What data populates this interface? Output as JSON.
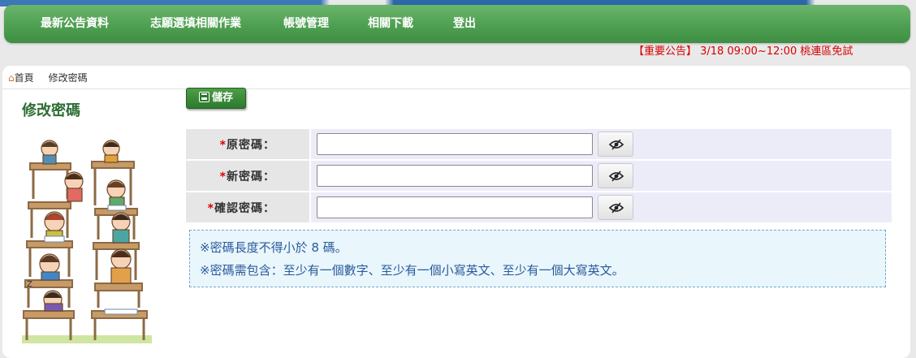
{
  "nav": {
    "items": [
      {
        "label": "最新公告資料"
      },
      {
        "label": "志願選填相關作業"
      },
      {
        "label": "帳號管理"
      },
      {
        "label": "相關下載"
      },
      {
        "label": "登出"
      }
    ]
  },
  "announcement": "【重要公告】 3/18 09:00~12:00 桃連區免試",
  "breadcrumb": {
    "home": "首頁",
    "current": "修改密碼"
  },
  "page_title": "修改密碼",
  "save_button": "儲存",
  "form": {
    "fields": [
      {
        "required": "*",
        "label": "原密碼：",
        "value": ""
      },
      {
        "required": "*",
        "label": "新密碼：",
        "value": ""
      },
      {
        "required": "*",
        "label": "確認密碼：",
        "value": ""
      }
    ]
  },
  "notes": [
    "※密碼長度不得小於 8 碼。",
    "※密碼需包含：至少有一個數字、至少有一個小寫英文、至少有一個大寫英文。"
  ],
  "icons": {
    "home": "home-icon",
    "save": "save-icon",
    "toggle_visibility": "eye-slash-icon"
  },
  "colors": {
    "nav_green": "#4f9f52",
    "title_green": "#2e6d34",
    "announce_red": "#d80000",
    "note_blue": "#2a5a9c"
  }
}
